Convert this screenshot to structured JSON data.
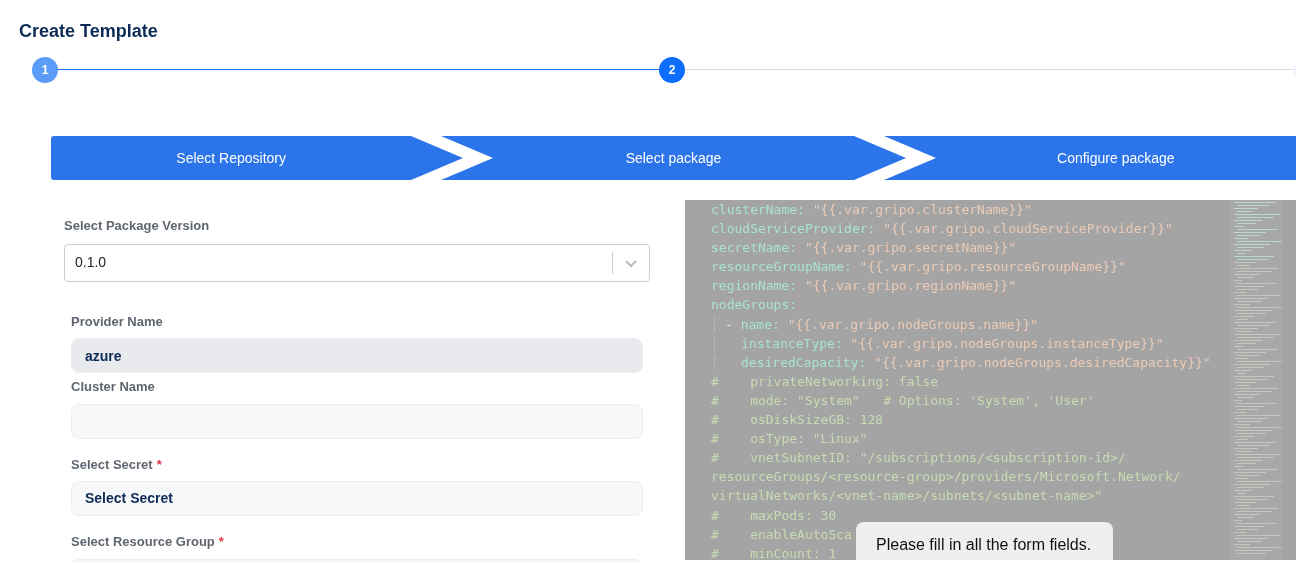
{
  "title": "Create Template",
  "stepper": [
    {
      "label": "1",
      "completed": true,
      "active": false
    },
    {
      "label": "2",
      "completed": false,
      "active": true
    },
    {
      "completed": false,
      "active": false
    }
  ],
  "wizard_steps": [
    {
      "label": "Select Repository"
    },
    {
      "label": "Select package"
    },
    {
      "label": "Configure package"
    }
  ],
  "form": {
    "version_select": {
      "label": "Select Package Version",
      "value": "0.1.0"
    },
    "fields": [
      {
        "kind": "input",
        "label": "Provider Name",
        "value": "azure",
        "disabled": true
      },
      {
        "kind": "input",
        "label": "Cluster Name",
        "disabled": false
      },
      {
        "kind": "select",
        "label": "Select Secret",
        "required_mark": "*",
        "value": "Select Secret",
        "disabled": false
      },
      {
        "kind": "select",
        "label": "Select Resource Group",
        "required_mark": "*",
        "disabled": false
      }
    ]
  },
  "code_lines": [
    {
      "kind": "pair",
      "key": "clusterName:",
      "value": "\"{{.var.gripo.clusterName}}\""
    },
    {
      "kind": "pair",
      "key": "cloudServiceProvider:",
      "value": "\"{{.var.gripo.cloudServiceProvider}}\""
    },
    {
      "kind": "pair",
      "key": "secretName:",
      "value": "\"{{.var.gripo.secretName}}\""
    },
    {
      "kind": "pair",
      "key": "resourceGroupName:",
      "value": "\"{{.var.gripo.resourceGroupName}}\""
    },
    {
      "kind": "pair",
      "key": "regionName:",
      "value": "\"{{.var.gripo.regionName}}\""
    },
    {
      "kind": "pair",
      "key": "nodeGroups:",
      "children": [
        {
          "kind": "pair",
          "prefix": "-",
          "key": "name:",
          "value": "\"{{.var.gripo.nodeGroups.name}}\""
        },
        {
          "kind": "pair",
          "key": "instanceType:",
          "value": "\"{{.var.gripo.nodeGroups.instanceType}}\""
        },
        {
          "kind": "pair",
          "key": "desiredCapacity:",
          "value": "\"{{.var.gripo.nodeGroups.desiredCapacity}}\""
        }
      ]
    },
    {
      "kind": "comment",
      "text": "#    privateNetworking: false"
    },
    {
      "kind": "comment",
      "text": "#    mode: \"System\"   # Options: 'System', 'User'"
    },
    {
      "kind": "comment",
      "text": "#    osDiskSizeGB: 128"
    },
    {
      "kind": "comment",
      "text": "#    osType: \"Linux\""
    },
    {
      "kind": "comment",
      "text": "#    vnetSubnetID: \"/subscriptions/<subscription-id>/"
    },
    {
      "kind": "comment",
      "text": "resourceGroups/<resource-group>/providers/Microsoft.Network/"
    },
    {
      "kind": "comment",
      "text": "virtualNetworks/<vnet-name>/subnets/<subnet-name>\""
    },
    {
      "kind": "comment",
      "text": "#    maxPods: 30"
    },
    {
      "kind": "comment",
      "text": "#    enableAutoSca"
    },
    {
      "kind": "comment",
      "text": "#    minCount: 1"
    }
  ],
  "toast": {
    "message": "Please fill in all the form fields."
  }
}
